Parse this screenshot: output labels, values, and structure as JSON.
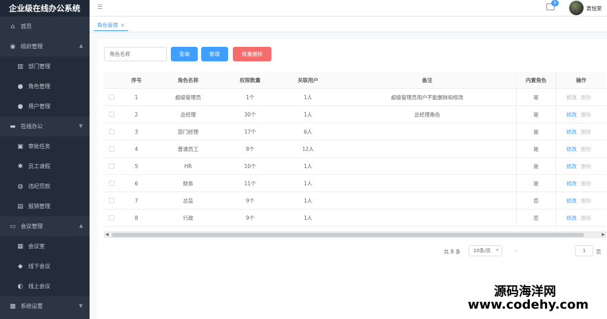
{
  "app": {
    "title": "企业级在线办公系统"
  },
  "sidebar": {
    "items": [
      {
        "label": "首页",
        "icon": "home-icon",
        "level": "top"
      },
      {
        "label": "组织管理",
        "icon": "org-icon",
        "level": "top",
        "expanded": true
      },
      {
        "label": "部门管理",
        "icon": "building-icon",
        "level": "sub"
      },
      {
        "label": "角色管理",
        "icon": "user-icon",
        "level": "sub"
      },
      {
        "label": "用户管理",
        "icon": "user-icon",
        "level": "sub"
      },
      {
        "label": "在线办公",
        "icon": "monitor-icon",
        "level": "top",
        "expanded": false
      },
      {
        "label": "审批任务",
        "icon": "briefcase-icon",
        "level": "sub"
      },
      {
        "label": "员工请假",
        "icon": "leave-icon",
        "level": "sub"
      },
      {
        "label": "违纪罚款",
        "icon": "fine-icon",
        "level": "sub"
      },
      {
        "label": "报销管理",
        "icon": "reimburse-icon",
        "level": "sub"
      },
      {
        "label": "会议管理",
        "icon": "meeting-icon",
        "level": "top",
        "expanded": true
      },
      {
        "label": "会议室",
        "icon": "room-icon",
        "level": "sub"
      },
      {
        "label": "线下会议",
        "icon": "diamond-icon",
        "level": "sub"
      },
      {
        "label": "线上会议",
        "icon": "headset-icon",
        "level": "sub"
      },
      {
        "label": "系统设置",
        "icon": "settings-icon",
        "level": "top",
        "expanded": false
      }
    ]
  },
  "header": {
    "badge": "0",
    "username": "黄悦荣"
  },
  "tabs": [
    {
      "label": "角色管理"
    }
  ],
  "toolbar": {
    "search_placeholder": "角色名称",
    "query_label": "查询",
    "add_label": "新增",
    "batch_delete_label": "批量删除"
  },
  "table": {
    "columns": [
      "序号",
      "角色名称",
      "权限数量",
      "关联用户",
      "备注",
      "内置角色",
      "操作"
    ],
    "edit_label": "修改",
    "delete_label": "删除",
    "rows": [
      {
        "idx": "1",
        "name": "超级管理员",
        "perms": "1个",
        "users": "1人",
        "note": "超级管理员用户不能删除和修改",
        "builtin": "是"
      },
      {
        "idx": "2",
        "name": "总经理",
        "perms": "30个",
        "users": "1人",
        "note": "总经理角色",
        "builtin": "是"
      },
      {
        "idx": "3",
        "name": "部门经理",
        "perms": "17个",
        "users": "6人",
        "note": "",
        "builtin": "是"
      },
      {
        "idx": "4",
        "name": "普通员工",
        "perms": "8个",
        "users": "12人",
        "note": "",
        "builtin": "是"
      },
      {
        "idx": "5",
        "name": "HR",
        "perms": "10个",
        "users": "1人",
        "note": "",
        "builtin": "是"
      },
      {
        "idx": "6",
        "name": "财务",
        "perms": "11个",
        "users": "1人",
        "note": "",
        "builtin": "是"
      },
      {
        "idx": "7",
        "name": "总监",
        "perms": "9个",
        "users": "1人",
        "note": "",
        "builtin": "否"
      },
      {
        "idx": "8",
        "name": "行政",
        "perms": "9个",
        "users": "1人",
        "note": "",
        "builtin": "否"
      }
    ]
  },
  "pagination": {
    "total": "共 8 条",
    "page_size": "10条/页",
    "current_page": "1",
    "page_unit": "页"
  },
  "watermark": {
    "line1": "源码海洋网",
    "line2": "www.codehy.com"
  }
}
